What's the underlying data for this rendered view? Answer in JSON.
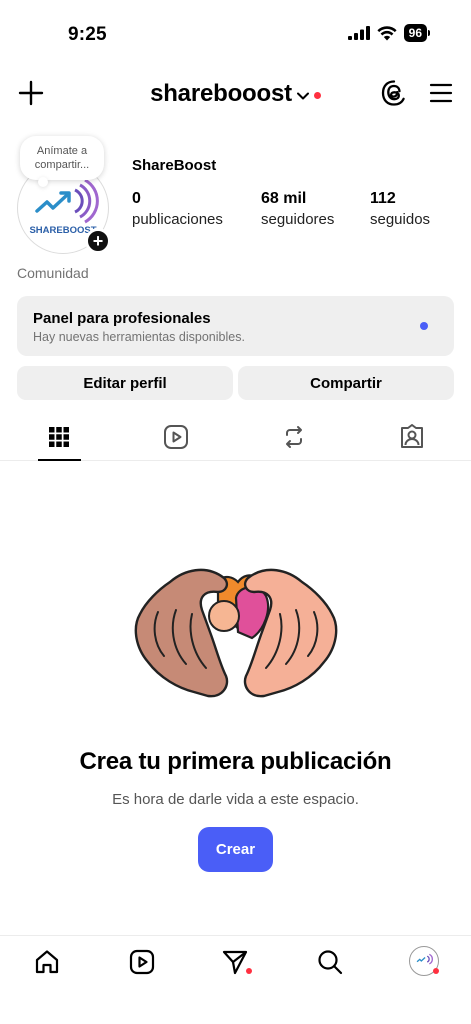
{
  "status_bar": {
    "time": "9:25",
    "battery": "96"
  },
  "header": {
    "username": "sharebooost",
    "icons": [
      "plus-icon",
      "chevron-down-icon",
      "threads-icon",
      "menu-icon"
    ]
  },
  "profile": {
    "note": "Anímate a compartir...",
    "display_name": "ShareBoost",
    "logo_text": "SHAREBOOST",
    "stats": [
      {
        "value": "0",
        "label": "publicaciones"
      },
      {
        "value": "68 mil",
        "label": "seguidores"
      },
      {
        "value": "112",
        "label": "seguidos"
      }
    ],
    "category": "Comunidad"
  },
  "pro_panel": {
    "title": "Panel para profesionales",
    "subtitle": "Hay nuevas herramientas disponibles."
  },
  "buttons": {
    "edit": "Editar perfil",
    "share": "Compartir"
  },
  "tabs": [
    "grid-icon",
    "reels-icon",
    "reposts-icon",
    "tagged-icon"
  ],
  "empty_state": {
    "title": "Crea tu primera publicación",
    "subtitle": "Es hora de darle vida a este espacio.",
    "cta": "Crear"
  },
  "bottom_nav": [
    "home-icon",
    "reels-icon",
    "messages-icon",
    "search-icon",
    "profile-avatar"
  ],
  "colors": {
    "accent": "#4a5ef7",
    "notification": "#ff3040",
    "panel_bg": "#efefef"
  }
}
